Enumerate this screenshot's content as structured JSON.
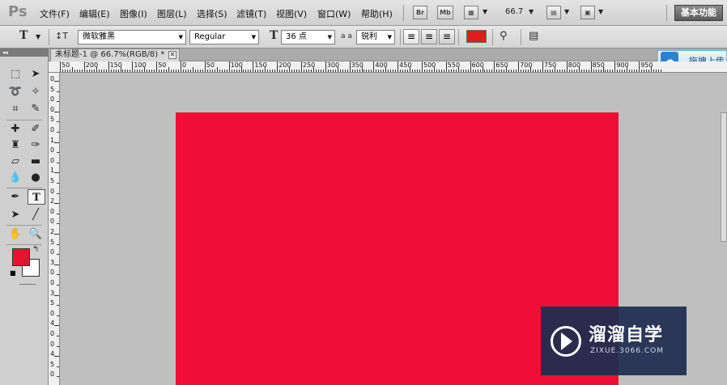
{
  "app": {
    "logo": "Ps"
  },
  "menu": [
    "文件(F)",
    "编辑(E)",
    "图像(I)",
    "图层(L)",
    "选择(S)",
    "滤镜(T)",
    "视图(V)",
    "窗口(W)",
    "帮助(H)"
  ],
  "menubar": {
    "bridge_label": "Br",
    "minibridge_label": "Mb",
    "zoom": "66.7",
    "workspace": "基本功能"
  },
  "options": {
    "font_family": "微软雅黑",
    "font_style": "Regular",
    "font_size": "36 点",
    "aa_label": "a a",
    "antialias": "锐利",
    "text_color": "#e31b1b"
  },
  "document": {
    "tab_title": "未标题-1 @ 66.7%(RGB/8) *",
    "canvas_color": "#f00e36"
  },
  "upload": {
    "label": "拖拽上传"
  },
  "ruler": {
    "h_labels": [
      "50",
      "200",
      "150",
      "100",
      "50",
      "0",
      "50",
      "100",
      "150",
      "200",
      "250",
      "300",
      "350",
      "400",
      "450",
      "500",
      "550",
      "600",
      "650",
      "700",
      "750",
      "800",
      "850",
      "900",
      "950"
    ],
    "v_labels": [
      "0",
      "5",
      "0",
      "0",
      "5",
      "0",
      "1",
      "0",
      "0",
      "1",
      "5",
      "0",
      "2",
      "0",
      "0",
      "2",
      "5",
      "0",
      "3",
      "0",
      "0",
      "3",
      "5",
      "0",
      "4",
      "0",
      "0",
      "4",
      "5",
      "0"
    ]
  },
  "toolbox": {
    "foreground": "#e8132f",
    "background": "#ffffff"
  },
  "watermark": {
    "title": "溜溜自学",
    "url": "ZIXUE.3066.COM"
  }
}
